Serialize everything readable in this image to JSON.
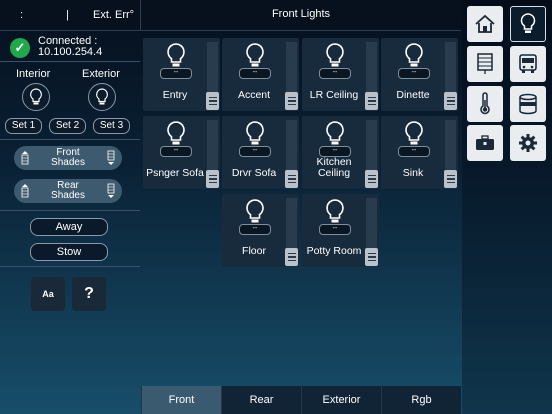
{
  "top": {
    "left_text_1": ":",
    "left_text_2": "|",
    "left_text_3": "Ext. Err°",
    "title": "Front Lights"
  },
  "status": {
    "connected_label": "Connected :",
    "ip": "10.100.254.4"
  },
  "groups": {
    "interior_label": "Interior",
    "exterior_label": "Exterior",
    "sets": [
      "Set 1",
      "Set 2",
      "Set 3"
    ]
  },
  "shades": {
    "front_label_1": "Front",
    "front_label_2": "Shades",
    "rear_label_1": "Rear",
    "rear_label_2": "Shades"
  },
  "modes": {
    "away": "Away",
    "stow": "Stow"
  },
  "tools": {
    "font_label": "Aa",
    "help_label": "?"
  },
  "lights": [
    {
      "name": "Entry",
      "level": "--"
    },
    {
      "name": "Accent",
      "level": "--"
    },
    {
      "name": "LR Ceiling",
      "level": "--"
    },
    {
      "name": "Dinette",
      "level": "--"
    },
    {
      "name": "Psnger Sofa",
      "level": "--"
    },
    {
      "name": "Drvr Sofa",
      "level": "--"
    },
    {
      "name_line1": "Kitchen",
      "name_line2": "Ceiling",
      "level": "--"
    },
    {
      "name": "Sink",
      "level": "--"
    },
    {
      "name": "Floor",
      "level": "--"
    },
    {
      "name": "Potty Room",
      "level": "--"
    }
  ],
  "tabs": [
    "Front",
    "Rear",
    "Exterior",
    "Rgb"
  ],
  "nav_icons": [
    "home-icon",
    "lightbulb-icon",
    "blinds-icon",
    "bus-icon",
    "thermometer-icon",
    "tank-icon",
    "toolbox-icon",
    "gear-icon"
  ],
  "colors": {
    "connected_green": "#20a84a",
    "active_tab": "#3a5a70",
    "tile_bg": "#182b3c"
  }
}
